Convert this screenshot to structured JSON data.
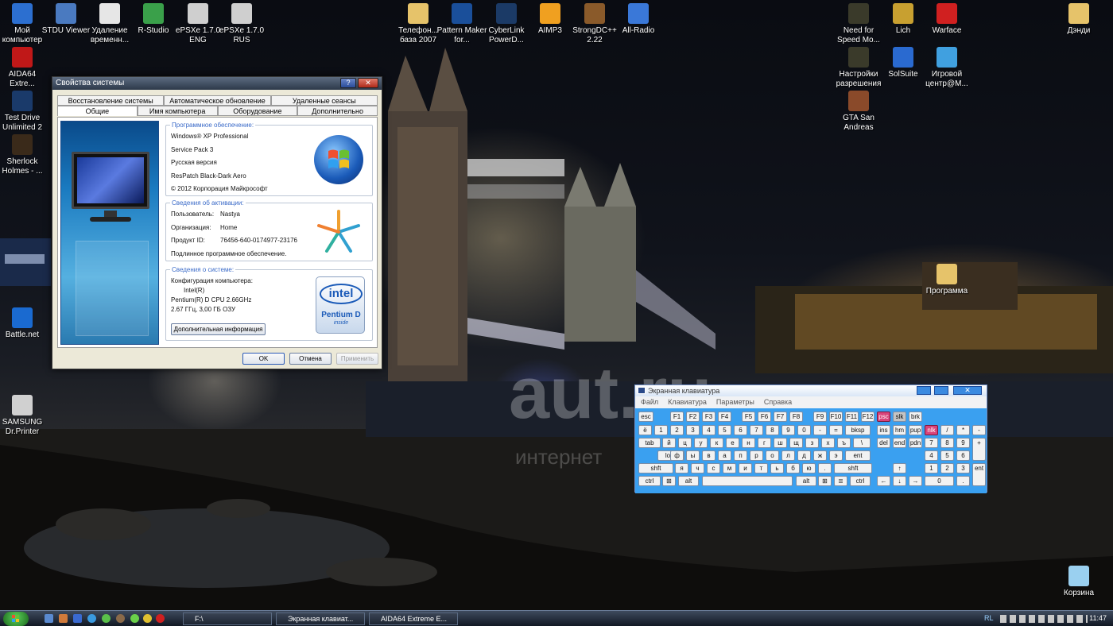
{
  "desktop": {
    "icons": [
      {
        "label": "Мой компьютер",
        "icon": "my-computer-icon",
        "color": "#2c6fd0"
      },
      {
        "label": "STDU Viewer",
        "icon": "stdu-viewer-icon",
        "color": "#4a7ac0"
      },
      {
        "label": "Удаление временн...",
        "icon": "temp-delete-icon",
        "color": "#e6e6e6"
      },
      {
        "label": "R-Studio",
        "icon": "r-studio-icon",
        "color": "#3aa04a"
      },
      {
        "label": "ePSXe 1.7.0 ENG",
        "icon": "gamepad-icon",
        "color": "#cfcfcf"
      },
      {
        "label": "ePSXe 1.7.0 RUS",
        "icon": "gamepad-icon",
        "color": "#cfcfcf"
      },
      {
        "label": "Телефон... база 2007",
        "icon": "folder-icon",
        "color": "#e6c36a"
      },
      {
        "label": "Pattern Maker for...",
        "icon": "pattern-maker-icon",
        "color": "#1a4f9a"
      },
      {
        "label": "CyberLink PowerD...",
        "icon": "cyberlink-icon",
        "color": "#1b3a66"
      },
      {
        "label": "AIMP3",
        "icon": "aimp-icon",
        "color": "#f0a020"
      },
      {
        "label": "StrongDC++ 2.22",
        "icon": "strongdc-icon",
        "color": "#8a5a2a"
      },
      {
        "label": "All-Radio",
        "icon": "all-radio-icon",
        "color": "#3a78d8"
      },
      {
        "label": "Need for Speed Mo...",
        "icon": "nfs-icon",
        "color": "#3a3a2a"
      },
      {
        "label": "Lich",
        "icon": "lich-icon",
        "color": "#c8a030"
      },
      {
        "label": "Warface",
        "icon": "warface-icon",
        "color": "#d02020"
      },
      {
        "label": "Дэнди",
        "icon": "folder-icon",
        "color": "#e6c36a"
      },
      {
        "label": "AIDA64 Extre...",
        "icon": "aida64-icon",
        "color": "#c01818"
      },
      {
        "label": "Настройки разрешения",
        "icon": "nfs-settings-icon",
        "color": "#3a3a2a"
      },
      {
        "label": "SolSuite",
        "icon": "solsuite-icon",
        "color": "#2a6ad0"
      },
      {
        "label": "Игровой центр@M...",
        "icon": "game-center-icon",
        "color": "#40a0e0"
      },
      {
        "label": "Test Drive Unlimited 2",
        "icon": "test-drive-icon",
        "color": "#1a3a6a"
      },
      {
        "label": "GTA San Andreas",
        "icon": "gta-icon",
        "color": "#8a4a2a"
      },
      {
        "label": "Sherlock Holmes - ...",
        "icon": "sherlock-icon",
        "color": "#3a2a1a"
      },
      {
        "label": "Программа",
        "icon": "folder-icon",
        "color": "#e6c36a"
      },
      {
        "label": "Battle.net",
        "icon": "battlenet-icon",
        "color": "#1a6ad0"
      },
      {
        "label": "SAMSUNG Dr.Printer",
        "icon": "printer-icon",
        "color": "#d0d0d0"
      },
      {
        "label": "Корзина",
        "icon": "recycle-bin-icon",
        "color": "#9ad0f0"
      }
    ]
  },
  "sysprops": {
    "title": "Свойства системы",
    "tabs_top": [
      "Восстановление системы",
      "Автоматическое обновление",
      "Удаленные сеансы"
    ],
    "tabs_bottom": [
      "Общие",
      "Имя компьютера",
      "Оборудование",
      "Дополнительно"
    ],
    "software": {
      "heading": "Программное обеспечение:",
      "os": "Windows® XP Professional",
      "sp": "Service Pack 3",
      "lang": "Русская версия",
      "patch": "ResPatch Black-Dark Aero",
      "copyright": "© 2012 Корпорация Майкрософт"
    },
    "activation": {
      "heading": "Сведения об активации:",
      "user_label": "Пользователь:",
      "user": "Nastya",
      "org_label": "Организация:",
      "org": "Home",
      "product_label": "Продукт ID:",
      "product": "76456-640-0174977-23176",
      "genuine": "Подлинное программное обеспечение."
    },
    "system": {
      "heading": "Сведения о системе:",
      "config": "Конфигурация компьютера:",
      "vendor": "Intel(R)",
      "cpu": "Pentium(R) D  CPU 2.66GHz",
      "ram": "2.67 ГГц, 3,00 ГБ ОЗУ",
      "more": "Дополнительная информация"
    },
    "badge": {
      "brand": "intel",
      "line1": "Pentium D",
      "line2": "inside"
    },
    "buttons": {
      "ok": "OK",
      "cancel": "Отмена",
      "apply": "Применить"
    }
  },
  "keyboard": {
    "title": "Экранная клавиатура",
    "menu": [
      "Файл",
      "Клавиатура",
      "Параметры",
      "Справка"
    ],
    "row1": [
      "esc",
      "F1",
      "F2",
      "F3",
      "F4",
      "F5",
      "F6",
      "F7",
      "F8",
      "F9",
      "F10",
      "F11",
      "F12",
      "psc",
      "slk",
      "brk"
    ],
    "row2": [
      "ё",
      "1",
      "2",
      "3",
      "4",
      "5",
      "6",
      "7",
      "8",
      "9",
      "0",
      "-",
      "=",
      "bksp",
      "ins",
      "hm",
      "pup",
      "nlk",
      "/",
      "*",
      "-"
    ],
    "row3": [
      "tab",
      "й",
      "ц",
      "у",
      "к",
      "е",
      "н",
      "г",
      "ш",
      "щ",
      "з",
      "х",
      "ъ",
      "\\",
      "del",
      "end",
      "pdn",
      "7",
      "8",
      "9",
      "+"
    ],
    "row4": [
      "lock",
      "ф",
      "ы",
      "в",
      "а",
      "п",
      "р",
      "о",
      "л",
      "д",
      "ж",
      "э",
      "ent",
      "4",
      "5",
      "6"
    ],
    "row5": [
      "shft",
      "я",
      "ч",
      "с",
      "м",
      "и",
      "т",
      "ь",
      "б",
      "ю",
      ".",
      "shft",
      "↑",
      "1",
      "2",
      "3",
      "ent"
    ],
    "row6": [
      "ctrl",
      "⊞",
      "alt",
      "",
      "alt",
      "⊞",
      "≣",
      "ctrl",
      "←",
      "↓",
      "→",
      "0",
      "."
    ]
  },
  "watermark": {
    "big": "aut.ru",
    "small": "интернет"
  },
  "taskbar": {
    "tasks": [
      "F:\\",
      "Экранная клавиат...",
      "AIDA64 Extreme E..."
    ],
    "lang": "RL",
    "clock": "11:47"
  }
}
